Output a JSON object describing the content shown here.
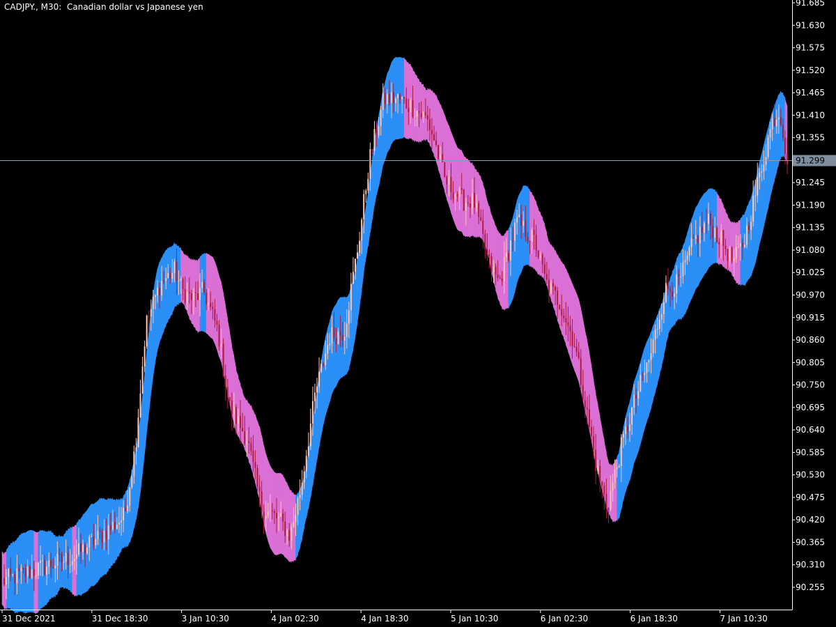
{
  "window": {
    "symbol_label": "CADJPY., M30:  Canadian dollar vs Japanese yen"
  },
  "current_price": {
    "value": 91.299,
    "label": "91.299"
  },
  "colors": {
    "background": "#000000",
    "axis": "#ffffff",
    "text": "#ffffff",
    "bull_candle": "#2e8b2e",
    "bear_candle": "#b01a3c",
    "bull_wick": "#ffc8b4",
    "ribbon_up": "#2a8ff7",
    "ribbon_down": "#da70d6",
    "price_line": "#8a9bb5",
    "price_label_bg": "#7f8e9f"
  },
  "chart_data": {
    "type": "candlestick",
    "ylim": [
      90.2,
      91.685
    ],
    "y_ticks": [
      "91.685",
      "91.630",
      "91.575",
      "91.520",
      "91.465",
      "91.410",
      "91.355",
      "91.300",
      "91.245",
      "91.190",
      "91.135",
      "91.080",
      "91.025",
      "90.970",
      "90.915",
      "90.860",
      "90.805",
      "90.750",
      "90.695",
      "90.640",
      "90.585",
      "90.530",
      "90.475",
      "90.420",
      "90.365",
      "90.310",
      "90.255"
    ],
    "x_ticks": [
      "31 Dec 2021",
      "31 Dec 18:30",
      "3 Jan 10:30",
      "4 Jan 02:30",
      "4 Jan 18:30",
      "5 Jan 10:30",
      "6 Jan 02:30",
      "6 Jan 18:30",
      "7 Jan 10:30"
    ],
    "price_path": [
      [
        0,
        90.27
      ],
      [
        2.0,
        90.33
      ],
      [
        3.0,
        90.4
      ],
      [
        3.4,
        90.43
      ],
      [
        3.7,
        90.6
      ],
      [
        4.0,
        90.9
      ],
      [
        4.4,
        91.0
      ],
      [
        4.8,
        91.03
      ],
      [
        5.0,
        90.98
      ],
      [
        5.3,
        90.96
      ],
      [
        5.6,
        90.98
      ],
      [
        6.0,
        90.88
      ],
      [
        6.3,
        90.7
      ],
      [
        6.8,
        90.62
      ],
      [
        7.2,
        90.45
      ],
      [
        7.7,
        90.42
      ],
      [
        8.0,
        90.38
      ],
      [
        8.3,
        90.5
      ],
      [
        8.7,
        90.73
      ],
      [
        9.1,
        90.87
      ],
      [
        9.5,
        90.88
      ],
      [
        9.9,
        91.1
      ],
      [
        10.2,
        91.3
      ],
      [
        10.6,
        91.45
      ],
      [
        11.0,
        91.45
      ],
      [
        11.4,
        91.43
      ],
      [
        11.8,
        91.4
      ],
      [
        12.0,
        91.35
      ],
      [
        12.3,
        91.25
      ],
      [
        12.8,
        91.2
      ],
      [
        13.1,
        91.2
      ],
      [
        13.5,
        91.05
      ],
      [
        13.8,
        91.0
      ],
      [
        14.3,
        91.15
      ],
      [
        14.8,
        91.1
      ],
      [
        15.1,
        91.0
      ],
      [
        15.5,
        90.95
      ],
      [
        15.9,
        90.85
      ],
      [
        16.2,
        90.7
      ],
      [
        16.5,
        90.55
      ],
      [
        16.8,
        90.45
      ],
      [
        17.2,
        90.6
      ],
      [
        17.6,
        90.72
      ],
      [
        18.0,
        90.82
      ],
      [
        18.4,
        90.98
      ],
      [
        18.8,
        91.0
      ],
      [
        19.2,
        91.1
      ],
      [
        19.6,
        91.15
      ],
      [
        20.0,
        91.1
      ],
      [
        20.3,
        91.05
      ],
      [
        20.6,
        91.1
      ],
      [
        21.0,
        91.25
      ],
      [
        21.4,
        91.4
      ],
      [
        21.6,
        91.42
      ],
      [
        21.8,
        91.3
      ]
    ]
  }
}
